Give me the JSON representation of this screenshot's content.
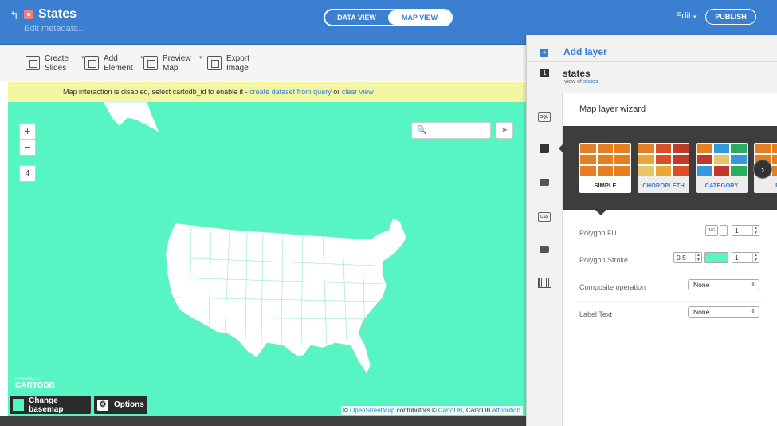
{
  "header": {
    "back_icon": "back-arrow-icon",
    "lock_icon": "lock-icon",
    "title": "States",
    "subtitle": "Edit metadata...",
    "view_toggle": {
      "data_view": "DATA VIEW",
      "map_view": "MAP VIEW",
      "active": "MAP VIEW"
    },
    "edit_label": "Edit",
    "publish_label": "PUBLISH",
    "bar_color": "#3b7fd1"
  },
  "toolbar": {
    "items": [
      {
        "label1": "Create",
        "label2": "Slides",
        "icon": "slides-icon"
      },
      {
        "label1": "Add",
        "label2": "Element",
        "icon": "element-icon"
      },
      {
        "label1": "Preview",
        "label2": "Map",
        "icon": "preview-icon"
      },
      {
        "label1": "Export",
        "label2": "Image",
        "icon": "image-icon"
      }
    ]
  },
  "warning": {
    "text": "Map interaction is disabled, select cartodb_id to enable it - ",
    "link1": "create dataset from query",
    "or": " or ",
    "link2": "clear view"
  },
  "map": {
    "fill_color": "#57f5c4",
    "zoom_in": "+",
    "zoom_out": "−",
    "zoom_level": "4",
    "search_icon": "🔍",
    "share_icon": "➤",
    "powered_by": "POWERED BY",
    "brand": "CARTODB",
    "change_basemap": "Change basemap",
    "options": "Options",
    "attribution": {
      "prefix": "© ",
      "osm": "OpenStreetMap",
      "mid": " contributors © ",
      "cartodb": "CartoDB",
      "mid2": ", CartoDB ",
      "attr": "attribution"
    }
  },
  "panel": {
    "add_layer": "Add layer",
    "layer_number": "1",
    "layer_name": "states",
    "layer_sub_prefix": "view of ",
    "layer_sub_link": "states",
    "sidebar_icons": [
      "sql-icon",
      "brush-icon",
      "comment-icon",
      "css-icon",
      "legend-icon",
      "histogram-icon"
    ],
    "sidebar_labels": {
      "sql": "SQL",
      "css": "CSS"
    },
    "wizard_title": "Map layer wizard",
    "cards": [
      {
        "label": "SIMPLE",
        "colors": [
          "#e67e22",
          "#e67e22",
          "#e67e22",
          "#e67e22",
          "#e67e22",
          "#e67e22",
          "#e67e22",
          "#e67e22",
          "#e67e22"
        ]
      },
      {
        "label": "CHOROPLETH",
        "colors": [
          "#e67e22",
          "#d94f2a",
          "#c0392b",
          "#e8a838",
          "#d94f2a",
          "#c0392b",
          "#e8c46a",
          "#e8a838",
          "#d94f2a"
        ]
      },
      {
        "label": "CATEGORY",
        "colors": [
          "#e67e22",
          "#3498db",
          "#27ae60",
          "#c0392b",
          "#e8c46a",
          "#3498db",
          "#3498db",
          "#c0392b",
          "#27ae60"
        ]
      },
      {
        "label": "BU",
        "colors": [
          "#e67e22",
          "#e67e22",
          "#e67e22",
          "#e67e22",
          "#e67e22",
          "#e67e22",
          "#e67e22",
          "#e67e22",
          "#e67e22"
        ]
      }
    ],
    "next_icon": "›",
    "properties": {
      "polygon_fill": {
        "label": "Polygon Fill",
        "img": "IMG",
        "opacity": "1"
      },
      "polygon_stroke": {
        "label": "Polygon Stroke",
        "width": "0.5",
        "opacity": "1",
        "color": "#57f5c4"
      },
      "composite": {
        "label": "Composite operation",
        "value": "None"
      },
      "label_text": {
        "label": "Label Text",
        "value": "None"
      }
    }
  }
}
